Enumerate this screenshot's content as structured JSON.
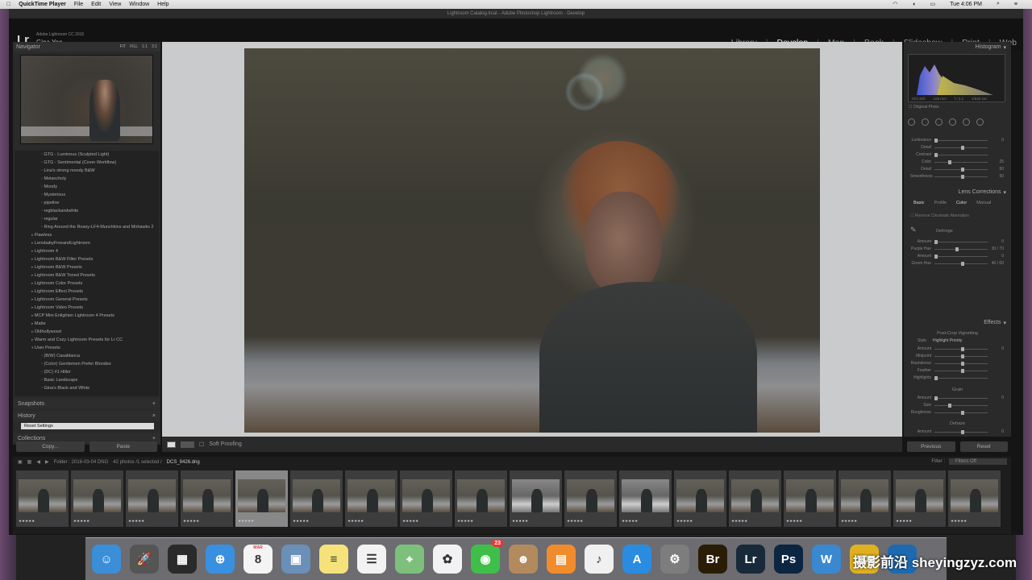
{
  "menubar": {
    "app": "QuickTime Player",
    "items": [
      "File",
      "Edit",
      "View",
      "Window",
      "Help"
    ],
    "clock": "Tue 4:06 PM"
  },
  "window": {
    "title": "Lightroom Catalog.lrcat - Adobe Photoshop Lightroom - Develop"
  },
  "identity": {
    "logo": "Lr",
    "version": "Adobe Lightroom CC 2015",
    "user": "Gina Yeo"
  },
  "modules": [
    "Library",
    "Develop",
    "Map",
    "Book",
    "Slideshow",
    "Print",
    "Web"
  ],
  "navigator": {
    "title": "Navigator",
    "zoom": [
      "FIT",
      "FILL",
      "1:1",
      "3:1"
    ]
  },
  "presets": [
    {
      "level": 2,
      "label": "GTG - Luminous (Sculpted Light)"
    },
    {
      "level": 2,
      "label": "GTG - Sentimental (Cover Workflow)"
    },
    {
      "level": 2,
      "label": "Lina's strong moody B&W"
    },
    {
      "level": 2,
      "label": "Melancholy"
    },
    {
      "level": 2,
      "label": "Moody"
    },
    {
      "level": 2,
      "label": "Mysterious"
    },
    {
      "level": 2,
      "label": "pipeline"
    },
    {
      "level": 2,
      "label": "regblackandwhite"
    },
    {
      "level": 2,
      "label": "regular"
    },
    {
      "level": 2,
      "label": "Ring Around the Rosey-LF4-Munchkins and Mohawks 2"
    },
    {
      "level": 1,
      "label": "Flawless"
    },
    {
      "level": 1,
      "label": "LensbabyFreeandLightroom"
    },
    {
      "level": 1,
      "label": "Lightroom 4"
    },
    {
      "level": 1,
      "label": "Lightroom B&W Filter Presets"
    },
    {
      "level": 1,
      "label": "Lightroom B&W Presets"
    },
    {
      "level": 1,
      "label": "Lightroom B&W Toned Presets"
    },
    {
      "level": 1,
      "label": "Lightroom Color Presets"
    },
    {
      "level": 1,
      "label": "Lightroom Effect Presets"
    },
    {
      "level": 1,
      "label": "Lightroom General Presets"
    },
    {
      "level": 1,
      "label": "Lightroom Video Presets"
    },
    {
      "level": 1,
      "label": "MCP Mini Enlighten Lightroom 4 Presets"
    },
    {
      "level": 1,
      "label": "Matte"
    },
    {
      "level": 1,
      "label": "Oldhollywood"
    },
    {
      "level": 1,
      "label": "Warm and Cozy Lightroom Presets for Lr CC"
    },
    {
      "level": 1,
      "label": "User Presets",
      "open": true
    },
    {
      "level": 2,
      "label": "(B/W) Casablanca"
    },
    {
      "level": 2,
      "label": "(Color) Gentlemen Prefer Blondes"
    },
    {
      "level": 2,
      "label": "(DC) #1 Hiller"
    },
    {
      "level": 2,
      "label": "Basic Landscape"
    },
    {
      "level": 2,
      "label": "Gina's Black and White"
    }
  ],
  "left_sections": {
    "snapshots": "Snapshots",
    "history": "History",
    "history_item": "Reset Settings",
    "collections": "Collections"
  },
  "left_buttons": {
    "copy": "Copy...",
    "paste": "Paste"
  },
  "center": {
    "soft_proofing": "Soft Proofing"
  },
  "right": {
    "histogram_title": "Histogram",
    "histo_vals": [
      "ISO 200",
      "105 mm",
      "f / 2.2",
      "1/640 sec"
    ],
    "original_photo": "Original Photo",
    "detail_sliders": [
      {
        "label": "Luminance",
        "value": "0",
        "pos": 0.0
      },
      {
        "label": "Detail",
        "value": "",
        "pos": 0.5
      },
      {
        "label": "Contrast",
        "value": "",
        "pos": 0.0
      },
      {
        "label": "Color",
        "value": "25",
        "pos": 0.25
      },
      {
        "label": "Detail",
        "value": "50",
        "pos": 0.5
      },
      {
        "label": "Smoothness",
        "value": "50",
        "pos": 0.5
      }
    ],
    "lens_title": "Lens Corrections",
    "lens_tabs": [
      "Basic",
      "Profile",
      "Color",
      "Manual"
    ],
    "remove_ca": "Remove Chromatic Aberration",
    "defringe": "Defringe",
    "defringe_sliders": [
      {
        "label": "Amount",
        "value": "0",
        "pos": 0.0
      },
      {
        "label": "Purple Hue",
        "value": "30 / 70",
        "pos": 0.4
      },
      {
        "label": "Amount",
        "value": "0",
        "pos": 0.0
      },
      {
        "label": "Green Hue",
        "value": "40 / 60",
        "pos": 0.5
      }
    ],
    "effects_title": "Effects",
    "vignetting": "Post-Crop Vignetting",
    "style_label": "Style",
    "style_value": "Highlight Priority",
    "vignette_sliders": [
      {
        "label": "Amount",
        "value": "0",
        "pos": 0.5
      },
      {
        "label": "Midpoint",
        "value": "",
        "pos": 0.5
      },
      {
        "label": "Roundness",
        "value": "",
        "pos": 0.5
      },
      {
        "label": "Feather",
        "value": "",
        "pos": 0.5
      },
      {
        "label": "Highlights",
        "value": "",
        "pos": 0.0
      }
    ],
    "grain": "Grain",
    "grain_sliders": [
      {
        "label": "Amount",
        "value": "0",
        "pos": 0.0
      },
      {
        "label": "Size",
        "value": "",
        "pos": 0.25
      },
      {
        "label": "Roughness",
        "value": "",
        "pos": 0.5
      }
    ],
    "dehaze": "Dehaze",
    "dehaze_sliders": [
      {
        "label": "Amount",
        "value": "0",
        "pos": 0.5
      }
    ]
  },
  "right_buttons": {
    "previous": "Previous",
    "reset": "Reset"
  },
  "filmstrip": {
    "folder": "Folder : 2016-03-04 DNG",
    "count": "42 photos /1 selected /",
    "file": "DCS_9426.dng",
    "filter_label": "Filter :",
    "filter_value": "Filters Off",
    "thumbs": [
      {
        "stars": "★★★★★"
      },
      {
        "stars": "★★★★★"
      },
      {
        "stars": "★★★★★"
      },
      {
        "stars": "★★★★★"
      },
      {
        "stars": "★★★★★",
        "selected": true
      },
      {
        "stars": "★★★★★"
      },
      {
        "stars": "★★★★★"
      },
      {
        "stars": "★★★★★"
      },
      {
        "stars": "★★★★★"
      },
      {
        "stars": "★★★★★",
        "bw": true
      },
      {
        "stars": "★★★★★"
      },
      {
        "stars": "★★★★★",
        "bw": true
      },
      {
        "stars": "★★★★★"
      },
      {
        "stars": "★★★★★"
      },
      {
        "stars": "★★★★★"
      },
      {
        "stars": "★★★★★"
      },
      {
        "stars": "★★★★★"
      },
      {
        "stars": "★★★★★"
      }
    ]
  },
  "dock": [
    {
      "name": "finder-icon",
      "glyph": "☺",
      "color": "#3b8ed8"
    },
    {
      "name": "launchpad-icon",
      "glyph": "🚀",
      "color": "#555"
    },
    {
      "name": "mission-control-icon",
      "glyph": "▦",
      "color": "#2a2a2a"
    },
    {
      "name": "safari-icon",
      "glyph": "⊕",
      "color": "#3a90e0"
    },
    {
      "name": "calendar-icon",
      "glyph": "8",
      "color": "#f4f4f4"
    },
    {
      "name": "preview-icon",
      "glyph": "▣",
      "color": "#6a8fb8"
    },
    {
      "name": "notes-icon",
      "glyph": "≡",
      "color": "#f5e27a"
    },
    {
      "name": "reminders-icon",
      "glyph": "☰",
      "color": "#f2f2f2"
    },
    {
      "name": "maps-icon",
      "glyph": "⌖",
      "color": "#7cc07c"
    },
    {
      "name": "photos-icon",
      "glyph": "✿",
      "color": "#f2f2f2"
    },
    {
      "name": "facetime-icon",
      "glyph": "◉",
      "color": "#3fbf4a",
      "badge": "23"
    },
    {
      "name": "contacts-icon",
      "glyph": "☻",
      "color": "#b38a5d"
    },
    {
      "name": "ibooks-icon",
      "glyph": "▤",
      "color": "#f18c2c"
    },
    {
      "name": "itunes-icon",
      "glyph": "♪",
      "color": "#f0f0f0"
    },
    {
      "name": "app-store-icon",
      "glyph": "A",
      "color": "#2a8ce0"
    },
    {
      "name": "system-preferences-icon",
      "glyph": "⚙",
      "color": "#7d7d7d"
    },
    {
      "name": "bridge-icon",
      "glyph": "Br",
      "color": "#2a1d05"
    },
    {
      "name": "lightroom-icon",
      "glyph": "Lr",
      "color": "#182a3a"
    },
    {
      "name": "photoshop-icon",
      "glyph": "Ps",
      "color": "#0c2540"
    },
    {
      "name": "wpp-icon",
      "glyph": "W",
      "color": "#3a88d0"
    },
    {
      "name": "o-app-icon",
      "glyph": "O",
      "color": "#e0b020"
    },
    {
      "name": "browser-icon",
      "glyph": "◐",
      "color": "#1e6ab0"
    }
  ],
  "calendar_month": "MAR",
  "watermark": "摄影前沿 sheyingzyz.com"
}
